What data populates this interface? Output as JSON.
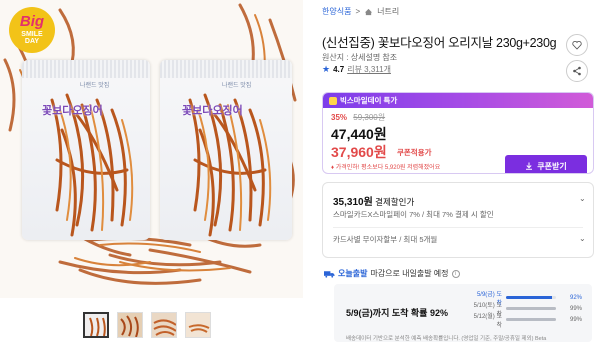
{
  "gallery": {
    "badge": {
      "line1": "Big",
      "line2": "SMILE",
      "line3": "DAY"
    },
    "bag_brand": "나랜드 맛집",
    "bag_title": "꽃보다오징어",
    "thumbnails": [
      {
        "active": true
      },
      {
        "active": false
      },
      {
        "active": false
      },
      {
        "active": false
      }
    ]
  },
  "breadcrumb": {
    "brand": "한양식품",
    "separator": ">",
    "category": "너트리"
  },
  "product": {
    "title": "(신선집중) 꽃보다오징어 오리지날 230g+230g",
    "origin": "원산지 : 상세설명 참조",
    "rating": "4.7",
    "review_count": "리뷰 3,311개"
  },
  "deal": {
    "header": "빅스마일데이 특가",
    "discount_pct": "35%",
    "original_price": "59,300원",
    "sale_price": "47,440원",
    "coupon_price": "37,960원",
    "coupon_label": "쿠폰적용가",
    "coupon_note": "♦ 가격인하! 평소보다 5,920원 저렴해졌어요",
    "coupon_button": "쿠폰받기"
  },
  "card": {
    "price": "35,310원",
    "price_suffix": "결제할인가",
    "detail": "스마일카드X스마일페이 7% / 최대 7% 결제 시 할인",
    "installment": "카드사별 무이자할부 / 최대 5개월"
  },
  "shipping": {
    "tag": "오늘출발",
    "desc": "마감으로 내일출발 예정",
    "headline": "5/9(금)까지 도착 확률 92%",
    "note": "배송데이터 기반으로 분석한 예측 배송확률입니다. (영업일 기준, 주말/공휴일 제외) Beta",
    "rows": [
      {
        "date": "5/9(금) 도착",
        "pct": "92%",
        "fill": 0.92
      },
      {
        "date": "5/10(토) 도착",
        "pct": "99%",
        "fill": 0.99
      },
      {
        "date": "5/12(월) 도착",
        "pct": "99%",
        "fill": 0.99
      }
    ]
  },
  "colors": {
    "accent": "#2a64d7",
    "sale": "#e24a4a",
    "purple": "#7b2ee0"
  }
}
